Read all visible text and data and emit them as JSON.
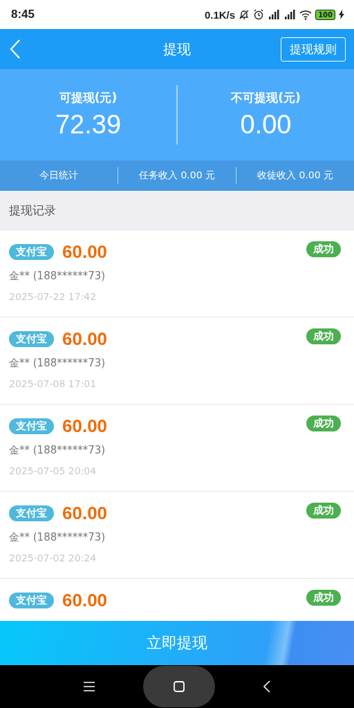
{
  "status_bar": {
    "time": "8:45",
    "net_speed": "0.1K/s",
    "battery": "100"
  },
  "header": {
    "title": "提现",
    "action": "提现规则"
  },
  "balances": [
    {
      "label": "可提现(元)",
      "amount": "72.39"
    },
    {
      "label": "不可提现(元)",
      "amount": "0.00"
    }
  ],
  "today_stats": [
    "今日统计",
    "任务收入 0.00 元",
    "收徒收入 0.00 元"
  ],
  "section_title": "提现记录",
  "records": [
    {
      "method": "支付宝",
      "amount": "60.00",
      "status": "成功",
      "account": "金** (188******73)",
      "time": "2025-07-22 17:42"
    },
    {
      "method": "支付宝",
      "amount": "60.00",
      "status": "成功",
      "account": "金** (188******73)",
      "time": "2025-07-08 17:01"
    },
    {
      "method": "支付宝",
      "amount": "60.00",
      "status": "成功",
      "account": "金** (188******73)",
      "time": "2025-07-05 20:04"
    },
    {
      "method": "支付宝",
      "amount": "60.00",
      "status": "成功",
      "account": "金** (188******73)",
      "time": "2025-07-02 20:24"
    },
    {
      "method": "支付宝",
      "amount": "60.00",
      "status": "成功"
    }
  ],
  "submit_button": "立即提现"
}
